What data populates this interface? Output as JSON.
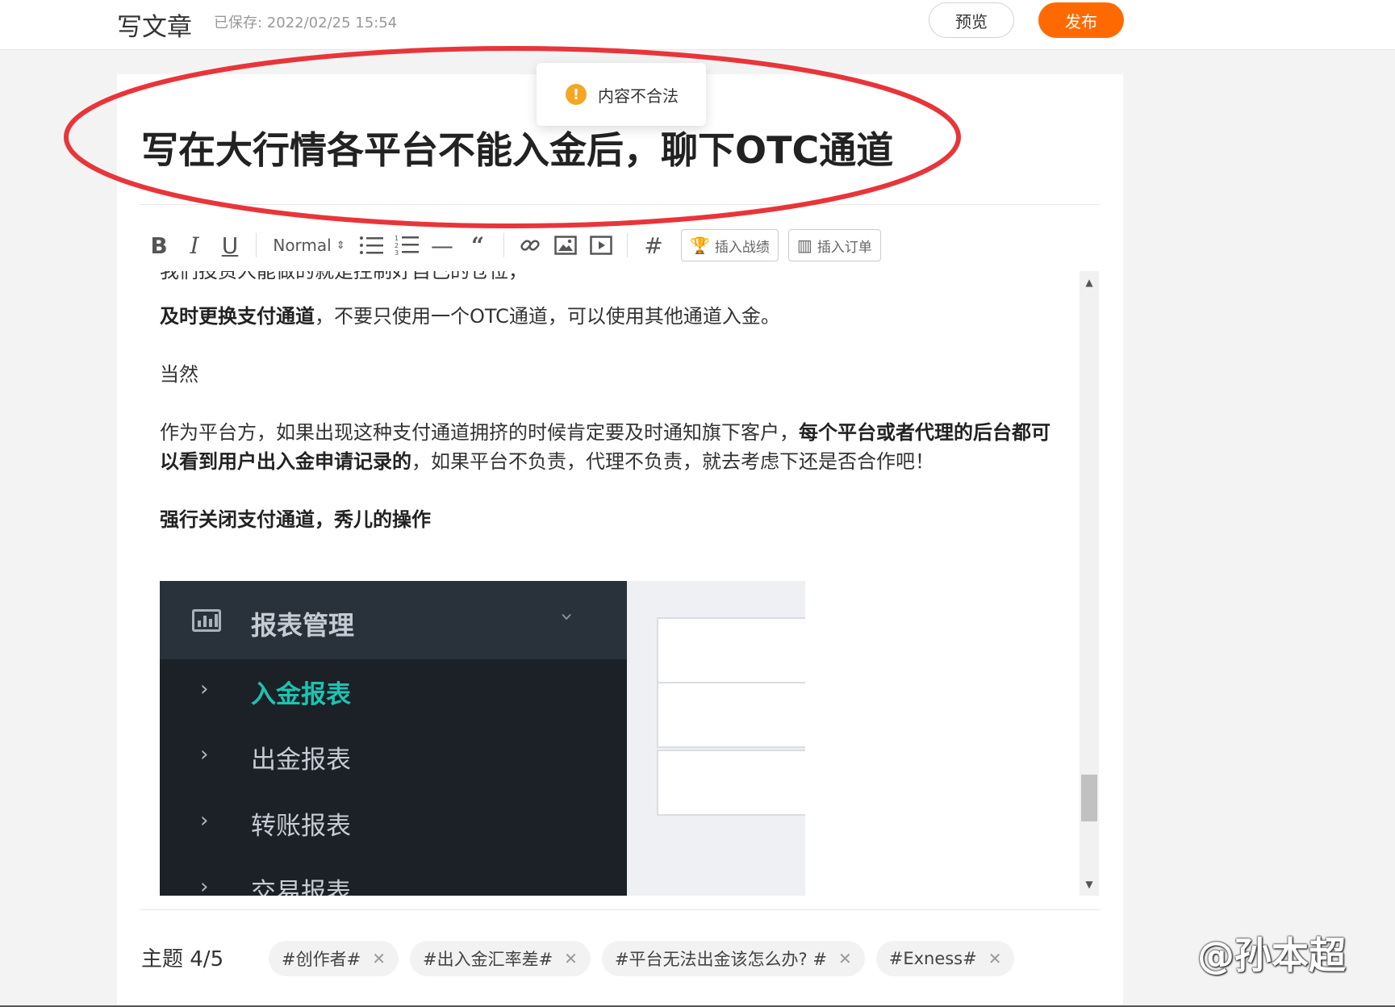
{
  "header": {
    "title": "写文章",
    "saved_status": "已保存: 2022/02/25 15:54",
    "preview_label": "预览",
    "publish_label": "发布"
  },
  "toast": {
    "message": "内容不合法"
  },
  "article": {
    "title": "写在大行情各平台不能入金后，聊下OTC通道"
  },
  "toolbar": {
    "format_select": "Normal",
    "insert_record_label": "插入战绩",
    "insert_order_label": "插入订单"
  },
  "content": {
    "p0": "我们投资人能做的就是控制好自己的仓位，",
    "p1_bold": "及时更换支付通道",
    "p1_rest": "，不要只使用一个OTC通道，可以使用其他通道入金。",
    "p2": "当然",
    "p3_start": "作为平台方，如果出现这种支付通道拥挤的时候肯定要及时通知旗下客户，",
    "p3_bold": "每个平台或者代理的后台都可以看到用户出入金申请记录的",
    "p3_end": "，如果平台不负责，代理不负责，就去考虑下还是否合作吧！",
    "p4_bold": "强行关闭支付通道，秀儿的操作"
  },
  "embedded_screenshot": {
    "menu_header": "报表管理",
    "menu_items": [
      "入金报表",
      "出金报表",
      "转账报表",
      "交易报表"
    ],
    "active_item_color": "#1fc2b0"
  },
  "topics": {
    "label": "主题 4/5",
    "tags": [
      "#创作者#",
      "#出入金汇率差#",
      "#平台无法出金该怎么办? #",
      "#Exness#"
    ]
  },
  "watermark": "@孙本超",
  "colors": {
    "accent": "#ff6a00",
    "annotation": "#e8353a",
    "warning": "#f5a623"
  }
}
